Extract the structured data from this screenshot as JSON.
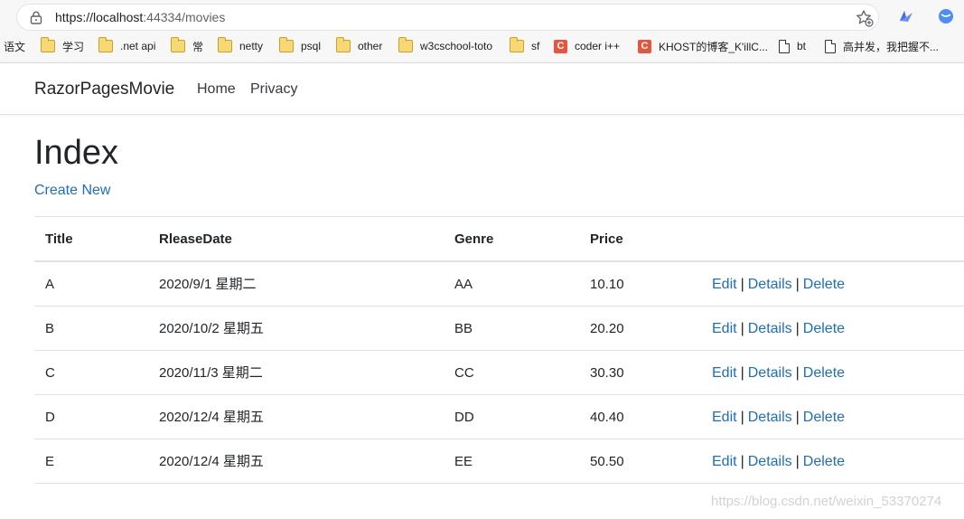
{
  "browser": {
    "url_host": "https://localhost",
    "url_rest": ":44334/movies",
    "bookmarks": [
      {
        "label": "语文",
        "icon": "none"
      },
      {
        "label": "学习",
        "icon": "folder-icon"
      },
      {
        "label": ".net api",
        "icon": "folder-icon"
      },
      {
        "label": "常",
        "icon": "folder-icon"
      },
      {
        "label": "netty",
        "icon": "folder-icon"
      },
      {
        "label": "psql",
        "icon": "folder-icon"
      },
      {
        "label": "other",
        "icon": "folder-icon"
      },
      {
        "label": "w3cschool-toto",
        "icon": "folder-icon"
      },
      {
        "label": "sf",
        "icon": "folder-icon"
      },
      {
        "label": "coder i++",
        "icon": "csdn-icon"
      },
      {
        "label": "KHOST的博客_K'illC...",
        "icon": "csdn-icon"
      },
      {
        "label": "bt",
        "icon": "page-icon"
      },
      {
        "label": "高并发，我把握不...",
        "icon": "page-icon"
      }
    ]
  },
  "navbar": {
    "brand": "RazorPagesMovie",
    "links": [
      "Home",
      "Privacy"
    ]
  },
  "page": {
    "title": "Index",
    "create_new": "Create New"
  },
  "table": {
    "headers": [
      "Title",
      "RleaseDate",
      "Genre",
      "Price"
    ],
    "rows": [
      {
        "title": "A",
        "date": "2020/9/1 星期二",
        "genre": "AA",
        "price": "10.10"
      },
      {
        "title": "B",
        "date": "2020/10/2 星期五",
        "genre": "BB",
        "price": "20.20"
      },
      {
        "title": "C",
        "date": "2020/11/3 星期二",
        "genre": "CC",
        "price": "30.30"
      },
      {
        "title": "D",
        "date": "2020/12/4 星期五",
        "genre": "DD",
        "price": "40.40"
      },
      {
        "title": "E",
        "date": "2020/12/4 星期五",
        "genre": "EE",
        "price": "50.50"
      }
    ],
    "actions": {
      "edit": "Edit",
      "details": "Details",
      "delete": "Delete",
      "separator": "|"
    }
  },
  "watermark": "https://blog.csdn.net/weixin_53370274",
  "colors": {
    "link": "#1b6ec2",
    "text": "#212529",
    "border": "#dee2e6"
  }
}
